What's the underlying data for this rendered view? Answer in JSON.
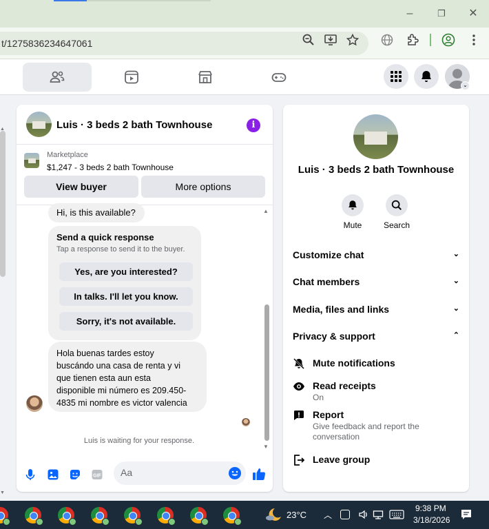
{
  "browser": {
    "url": "t/1275836234647061"
  },
  "nav": {
    "tabs": [
      {
        "name": "friends",
        "active": true
      },
      {
        "name": "watch",
        "active": false
      },
      {
        "name": "marketplace",
        "active": false
      },
      {
        "name": "gaming",
        "active": false
      }
    ]
  },
  "chat": {
    "title": "Luis · 3 beds 2 bath Townhouse",
    "marketplace_label": "Marketplace",
    "listing": "$1,247 - 3 beds 2 bath Townhouse",
    "view_buyer": "View buyer",
    "more_options": "More options",
    "first_message": "Hi, is this available?",
    "quick_response": {
      "title": "Send a quick response",
      "subtitle": "Tap a response to send it to the buyer.",
      "options": [
        "Yes, are you interested?",
        "In talks. I'll let you know.",
        "Sorry, it's not available."
      ]
    },
    "buyer_message": [
      "Hola buenas tardes estoy",
      "buscándo una casa de renta y vi",
      "que tienen esta aun esta",
      "disponible mi número es 209.450-",
      "4835 mi nombre es victor valencia"
    ],
    "waiting": "Luis is waiting for your response.",
    "composer_placeholder": "Aa"
  },
  "info": {
    "title": "Luis · 3 beds 2 bath Townhouse",
    "actions": [
      "Mute",
      "Search"
    ],
    "sections": [
      "Customize chat",
      "Chat members",
      "Media, files and links",
      "Privacy & support"
    ],
    "privacy_options": [
      {
        "title": "Mute notifications",
        "subtitle": ""
      },
      {
        "title": "Read receipts",
        "subtitle": "On"
      },
      {
        "title": "Report",
        "subtitle": "Give feedback and report the conversation"
      },
      {
        "title": "Leave group",
        "subtitle": ""
      }
    ]
  },
  "taskbar": {
    "temperature": "23°C",
    "time": "9:38 PM",
    "date": "3/18/2026"
  },
  "colors": {
    "messenger_blue": "#0866ff",
    "info_purple": "#8a1fe6"
  }
}
